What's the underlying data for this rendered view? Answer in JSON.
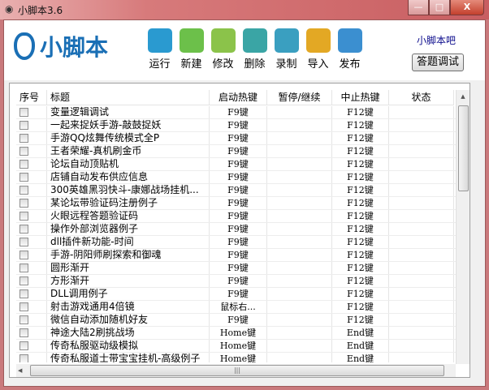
{
  "window": {
    "title": "小脚本3.6"
  },
  "logo": {
    "text": "小脚本"
  },
  "toolbar": [
    {
      "label": "运行",
      "icon": "play-icon",
      "color": "#2a9ad0"
    },
    {
      "label": "新建",
      "icon": "new-file-icon",
      "color": "#6cc04a"
    },
    {
      "label": "修改",
      "icon": "edit-icon",
      "color": "#8bc34a"
    },
    {
      "label": "删除",
      "icon": "trash-icon",
      "color": "#3aa5a5"
    },
    {
      "label": "录制",
      "icon": "camera-icon",
      "color": "#3a9fc0"
    },
    {
      "label": "导入",
      "icon": "import-icon",
      "color": "#e3a824"
    },
    {
      "label": "发布",
      "icon": "publish-globe-icon",
      "color": "#3b8fd0"
    }
  ],
  "forum_link": "小脚本吧",
  "qa_debug_button": "答题调试",
  "table": {
    "columns": [
      "序号",
      "标题",
      "启动热键",
      "暂停/继续",
      "中止热键",
      "状态"
    ],
    "rows": [
      {
        "title": "变量逻辑调试",
        "start": "F9键",
        "pause": "",
        "stop": "F12键",
        "status": ""
      },
      {
        "title": "一起来捉妖手游-敲鼓捉妖",
        "start": "F9键",
        "pause": "",
        "stop": "F12键",
        "status": ""
      },
      {
        "title": "手游QQ炫舞传统模式全P",
        "start": "F9键",
        "pause": "",
        "stop": "F12键",
        "status": ""
      },
      {
        "title": "王者荣耀-真机刷金币",
        "start": "F9键",
        "pause": "",
        "stop": "F12键",
        "status": ""
      },
      {
        "title": "论坛自动顶贴机",
        "start": "F9键",
        "pause": "",
        "stop": "F12键",
        "status": ""
      },
      {
        "title": "店铺自动发布供应信息",
        "start": "F9键",
        "pause": "",
        "stop": "F12键",
        "status": ""
      },
      {
        "title": "300英雄黑羽快斗-康娜战场挂机...",
        "start": "F9键",
        "pause": "",
        "stop": "F12键",
        "status": ""
      },
      {
        "title": "某论坛带验证码注册例子",
        "start": "F9键",
        "pause": "",
        "stop": "F12键",
        "status": ""
      },
      {
        "title": "火眼远程答题验证码",
        "start": "F9键",
        "pause": "",
        "stop": "F12键",
        "status": ""
      },
      {
        "title": "操作外部浏览器例子",
        "start": "F9键",
        "pause": "",
        "stop": "F12键",
        "status": ""
      },
      {
        "title": "dll插件新功能-时间",
        "start": "F9键",
        "pause": "",
        "stop": "F12键",
        "status": ""
      },
      {
        "title": "手游-阴阳师刷探索和御魂",
        "start": "F9键",
        "pause": "",
        "stop": "F12键",
        "status": ""
      },
      {
        "title": "圆形渐开",
        "start": "F9键",
        "pause": "",
        "stop": "F12键",
        "status": ""
      },
      {
        "title": "方形渐开",
        "start": "F9键",
        "pause": "",
        "stop": "F12键",
        "status": ""
      },
      {
        "title": "DLL调用例子",
        "start": "F9键",
        "pause": "",
        "stop": "F12键",
        "status": ""
      },
      {
        "title": "射击游戏通用4倍镜",
        "start": "鼠标右...",
        "pause": "",
        "stop": "F12键",
        "status": ""
      },
      {
        "title": "微信自动添加随机好友",
        "start": "F9键",
        "pause": "",
        "stop": "F12键",
        "status": ""
      },
      {
        "title": "神途大陆2刷挑战场",
        "start": "Home键",
        "pause": "",
        "stop": "End键",
        "status": ""
      },
      {
        "title": "传奇私服驱动级模拟",
        "start": "Home键",
        "pause": "",
        "stop": "End键",
        "status": ""
      },
      {
        "title": "传奇私服道士带宝宝挂机-高级例子",
        "start": "Home键",
        "pause": "",
        "stop": "End键",
        "status": ""
      }
    ]
  }
}
